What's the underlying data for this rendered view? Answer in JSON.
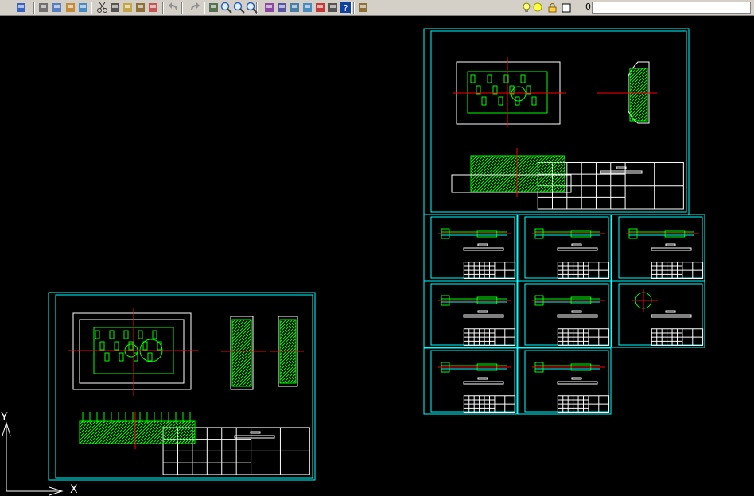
{
  "toolbar": {
    "tools": [
      {
        "name": "save-icon"
      },
      {
        "name": "plot-icon"
      },
      {
        "name": "plot-preview-icon"
      },
      {
        "name": "publish-icon"
      },
      {
        "name": "3d-dwf-icon"
      },
      {
        "name": "cut-icon"
      },
      {
        "name": "copy-icon"
      },
      {
        "name": "paste-icon"
      },
      {
        "name": "match-properties-icon"
      },
      {
        "name": "block-editor-icon"
      },
      {
        "name": "undo-icon"
      },
      {
        "name": "redo-icon"
      },
      {
        "name": "pan-icon"
      },
      {
        "name": "zoom-realtime-icon"
      },
      {
        "name": "zoom-window-icon"
      },
      {
        "name": "zoom-previous-icon"
      },
      {
        "name": "properties-icon"
      },
      {
        "name": "design-center-icon"
      },
      {
        "name": "tool-palettes-icon"
      },
      {
        "name": "sheet-set-icon"
      },
      {
        "name": "markup-icon"
      },
      {
        "name": "calculator-icon"
      },
      {
        "name": "help-icon"
      },
      {
        "name": "layer-manager-icon"
      }
    ],
    "layer_control": {
      "current_layer": "0",
      "icons": [
        "lightbulb-icon",
        "sun-icon",
        "lock-icon",
        "color-swatch-icon"
      ]
    }
  },
  "ucs": {
    "x_label": "X",
    "y_label": "Y"
  },
  "colors": {
    "background": "#000000",
    "frame": "#00ffff",
    "geometry": "#00ff00",
    "centerline": "#ff0000",
    "text": "#ffffff",
    "toolbar": "#d4d0c8"
  }
}
